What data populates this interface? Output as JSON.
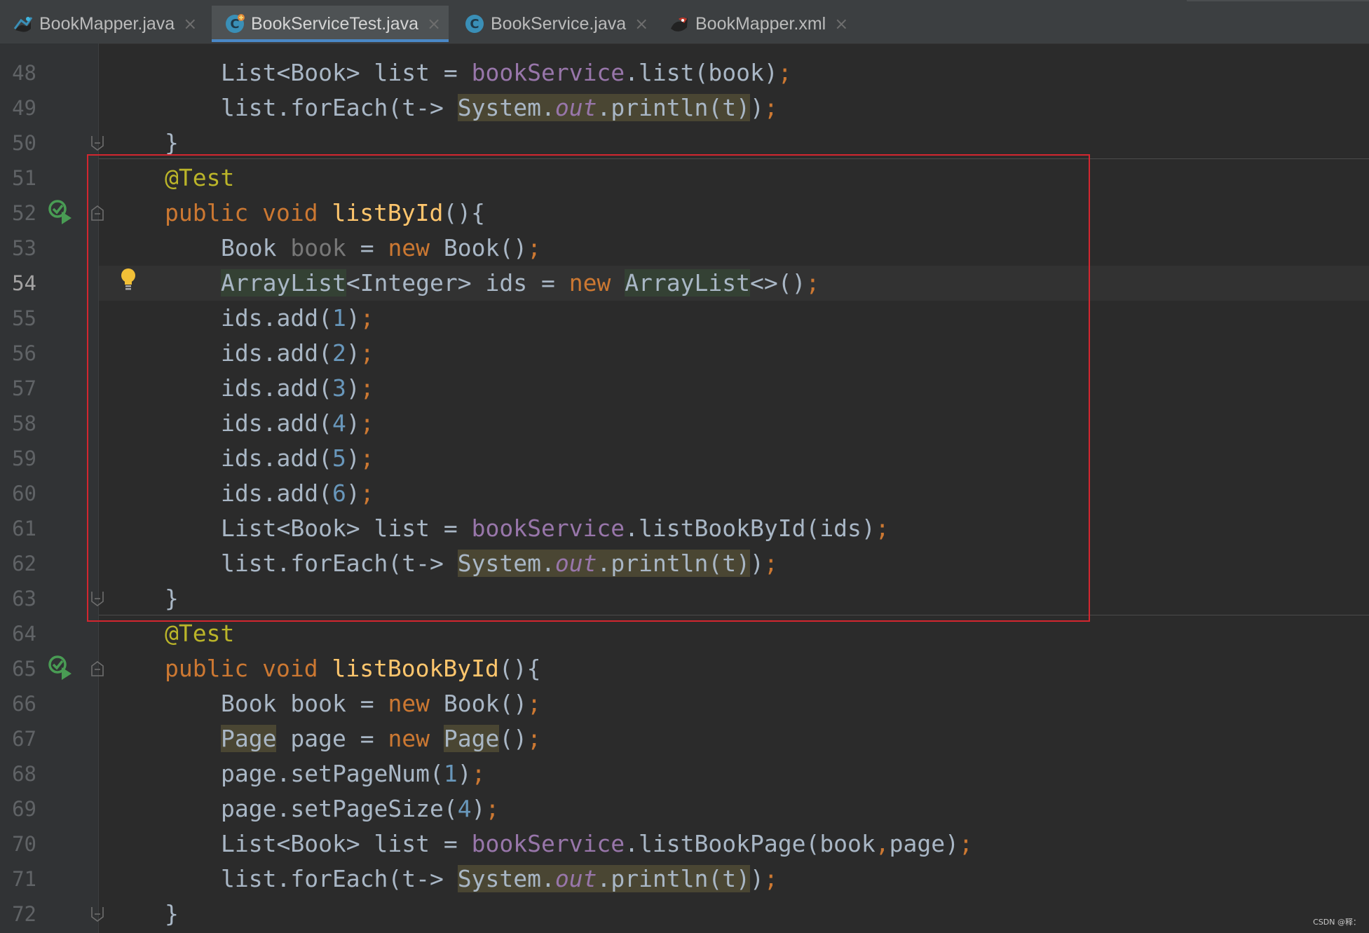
{
  "tabs": [
    {
      "label": "BookMapper.java",
      "icon": "mapper-interface-icon",
      "active": false
    },
    {
      "label": "BookServiceTest.java",
      "icon": "class-icon",
      "active": true
    },
    {
      "label": "BookService.java",
      "icon": "class-icon",
      "active": false
    },
    {
      "label": "BookMapper.xml",
      "icon": "mybatis-xml-icon",
      "active": false
    }
  ],
  "close_glyph": "×",
  "class_letter": "C",
  "lines": [
    {
      "num": "48"
    },
    {
      "num": "49"
    },
    {
      "num": "50"
    },
    {
      "num": "51"
    },
    {
      "num": "52"
    },
    {
      "num": "53"
    },
    {
      "num": "54"
    },
    {
      "num": "55"
    },
    {
      "num": "56"
    },
    {
      "num": "57"
    },
    {
      "num": "58"
    },
    {
      "num": "59"
    },
    {
      "num": "60"
    },
    {
      "num": "61"
    },
    {
      "num": "62"
    },
    {
      "num": "63"
    },
    {
      "num": "64"
    },
    {
      "num": "65"
    },
    {
      "num": "66"
    },
    {
      "num": "67"
    },
    {
      "num": "68"
    },
    {
      "num": "69"
    },
    {
      "num": "70"
    },
    {
      "num": "71"
    },
    {
      "num": "72"
    }
  ],
  "code": {
    "t": {
      "list_decl": "List<Book> list = ",
      "book_service": "bookService",
      "list_call": ".list(book)",
      "foreach": "list.forEach(t-> ",
      "system": "System",
      "dot": ".",
      "out": "out",
      "println": ".println(t)",
      "close_paren": ")",
      "semi": ";",
      "rbrace": "}",
      "test_ann": "@Test",
      "public": "public",
      "void": "void",
      "listById": "listById",
      "paren_brace": "(){",
      "book_type": "Book ",
      "book_var": "book",
      "eq": " = ",
      "new": "new",
      "book_ctor": " Book()",
      "arraylist": "ArrayList",
      "integer_ids": "<Integer> ids = ",
      "diamond": "<>()",
      "ids_add": "ids.add(",
      "n1": "1",
      "n2": "2",
      "n3": "3",
      "n4": "4",
      "n5": "5",
      "n6": "6",
      "listBookById_call": ".listBookById(ids)",
      "listBookById": "listBookById",
      "page_type": "Page",
      "page_var": " page = ",
      "page_ctor": "Page",
      "empty_parens": "()",
      "set_page_num": "page.setPageNum(",
      "set_page_size": "page.setPageSize(",
      "list_book_page": ".listBookPage(book",
      "comma": ",",
      "page_arg": "page)"
    }
  },
  "colors": {
    "background": "#2b2b2b",
    "gutter": "#313335",
    "keyword": "#cc7832",
    "annotation": "#bbb529",
    "method_decl": "#ffc66d",
    "field": "#9876aa",
    "number": "#6897bb",
    "default_text": "#a9b7c6",
    "selection_box": "#d3262f"
  },
  "watermark": "CSDN @释："
}
